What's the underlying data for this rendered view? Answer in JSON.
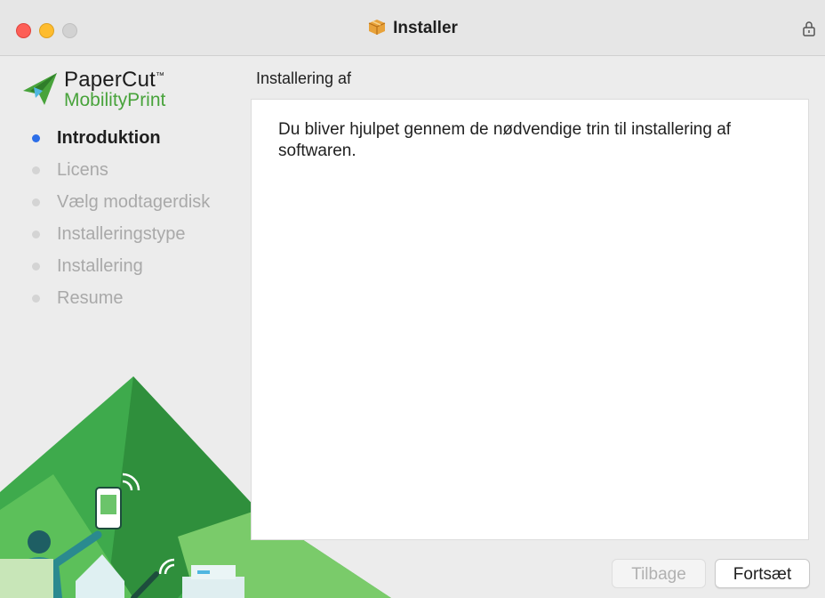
{
  "window": {
    "title": "Installer",
    "title_icon": "package-box-icon",
    "lock_icon": "lock-icon"
  },
  "logo": {
    "line1": "PaperCut",
    "line1_mark": "™",
    "line2": "MobilityPrint",
    "colors": {
      "green": "#48a33b",
      "dark": "#1c1c1c"
    }
  },
  "steps": [
    {
      "label": "Introduktion",
      "active": true
    },
    {
      "label": "Licens",
      "active": false
    },
    {
      "label": "Vælg modtagerdisk",
      "active": false
    },
    {
      "label": "Installeringstype",
      "active": false
    },
    {
      "label": "Installering",
      "active": false
    },
    {
      "label": "Resume",
      "active": false
    }
  ],
  "main": {
    "heading": "Installering af",
    "body": "Du bliver hjulpet gennem de nødvendige trin til installering af softwaren."
  },
  "buttons": {
    "back": {
      "label": "Tilbage",
      "enabled": false
    },
    "next": {
      "label": "Fortsæt",
      "enabled": true
    }
  },
  "colors": {
    "active_dot": "#2c6ee8",
    "inactive_dot": "#d4d4d4",
    "illustration_green": "#3eaa4c"
  }
}
